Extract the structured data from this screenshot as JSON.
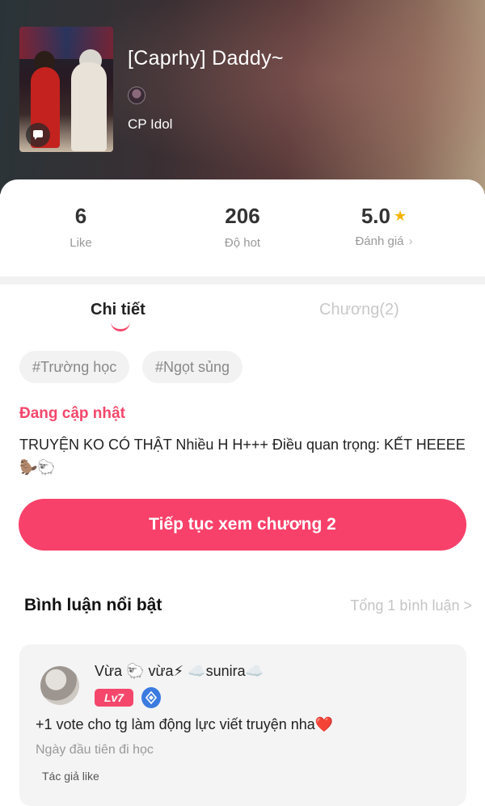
{
  "book": {
    "title": "[Caprhy] Daddy~",
    "category": "CP Idol"
  },
  "stats": [
    {
      "value": "6",
      "label": "Like"
    },
    {
      "value": "206",
      "label": "Độ hot"
    },
    {
      "value": "5.0",
      "label": "Đánh giá",
      "chevron": "›"
    }
  ],
  "tabs": {
    "detail": "Chi tiết",
    "chapters": "Chương(2)"
  },
  "tags": [
    "#Trường học",
    "#Ngọt sủng"
  ],
  "status": "Đang cập nhật",
  "description": "TRUYỆN KO CÓ THẬT Nhiều H H+++ Điều quan trọng: KẾT HEEEE🦫🐑",
  "cta_label": "Tiếp tục xem chương 2",
  "comments_section": {
    "title": "Bình luận nổi bật",
    "total": "Tổng 1 bình luận >"
  },
  "comment": {
    "username": "Vừa 🐑 vừa⚡ ☁️sunira☁️",
    "level": "Lv7",
    "text": "+1 vote cho tg làm động lực viết truyện nha❤️",
    "chapter": "Ngày đầu tiên đi học",
    "author_like": "Tác giả like"
  },
  "colors": {
    "accent": "#f8416a",
    "star": "#f5b400",
    "level_badge": "#f4476b",
    "shield": "#3b7be0"
  },
  "icons": [
    "chat-icon",
    "star-icon",
    "shield-icon"
  ]
}
